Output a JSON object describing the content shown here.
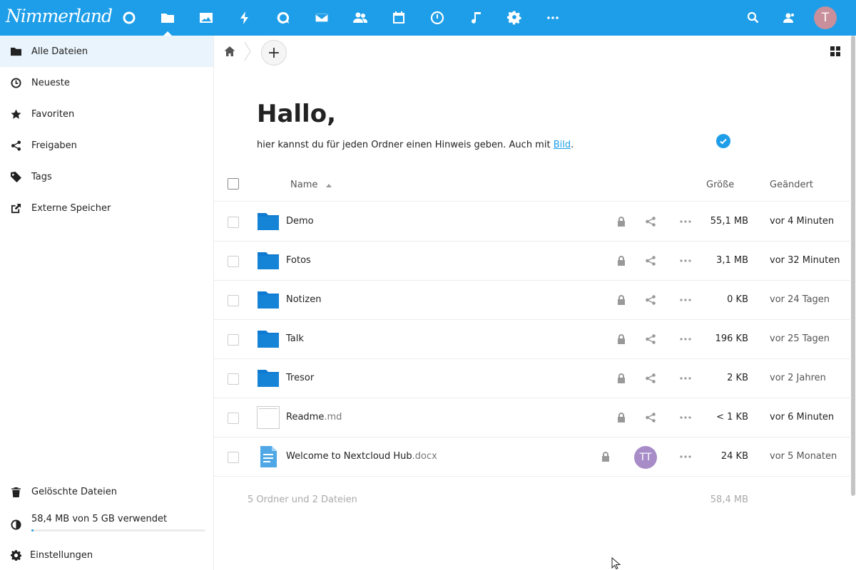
{
  "header": {
    "logo": "Nimmerland",
    "apps": [
      {
        "name": "dashboard-icon"
      },
      {
        "name": "files-icon",
        "active": true
      },
      {
        "name": "photos-icon"
      },
      {
        "name": "activity-icon"
      },
      {
        "name": "talk-icon"
      },
      {
        "name": "mail-icon"
      },
      {
        "name": "contacts-icon"
      },
      {
        "name": "calendar-icon"
      },
      {
        "name": "deck-icon"
      },
      {
        "name": "music-icon"
      },
      {
        "name": "settings-icon"
      },
      {
        "name": "more-apps-icon"
      }
    ],
    "avatar_initial": "T",
    "colors": {
      "bar": "#1e9ee8",
      "avatar": "#c98f9a"
    }
  },
  "sidebar": {
    "items": [
      {
        "label": "Alle Dateien",
        "icon": "folder-icon"
      },
      {
        "label": "Neueste",
        "icon": "clock-icon"
      },
      {
        "label": "Favoriten",
        "icon": "star-icon"
      },
      {
        "label": "Freigaben",
        "icon": "share-icon"
      },
      {
        "label": "Tags",
        "icon": "tag-icon"
      },
      {
        "label": "Externe Speicher",
        "icon": "external-link-icon"
      }
    ],
    "deleted": "Gelöschte Dateien",
    "quota": "58,4 MB von 5 GB verwendet",
    "quota_fraction": 0.0114,
    "settings": "Einstellungen"
  },
  "main": {
    "add_label": "+",
    "greeting": "Hallo,",
    "note_text": "hier kannst du für jeden Ordner einen Hinweis geben. Auch mit ",
    "note_link": "Bild",
    "note_end": ".",
    "columns": {
      "name": "Name",
      "size": "Größe",
      "modified": "Geändert"
    },
    "files": [
      {
        "name": "Demo",
        "ext": "",
        "type": "folder",
        "size": "55,1 MB",
        "modified": "vor 4 Minuten"
      },
      {
        "name": "Fotos",
        "ext": "",
        "type": "folder",
        "size": "3,1 MB",
        "modified": "vor 32 Minuten"
      },
      {
        "name": "Notizen",
        "ext": "",
        "type": "folder",
        "size": "0 KB",
        "modified": "vor 24 Tagen"
      },
      {
        "name": "Talk",
        "ext": "",
        "type": "folder",
        "size": "196 KB",
        "modified": "vor 25 Tagen"
      },
      {
        "name": "Tresor",
        "ext": "",
        "type": "folder",
        "size": "2 KB",
        "modified": "vor 2 Jahren"
      },
      {
        "name": "Readme",
        "ext": ".md",
        "type": "text",
        "size": "< 1 KB",
        "modified": "vor 6 Minuten"
      },
      {
        "name": "Welcome to Nextcloud Hub",
        "ext": ".docx",
        "type": "document",
        "size": "24 KB",
        "modified": "vor 5 Monaten",
        "shared_with": "TT"
      }
    ],
    "summary": "5 Ordner und 2 Dateien",
    "summary_size": "58,4 MB"
  }
}
